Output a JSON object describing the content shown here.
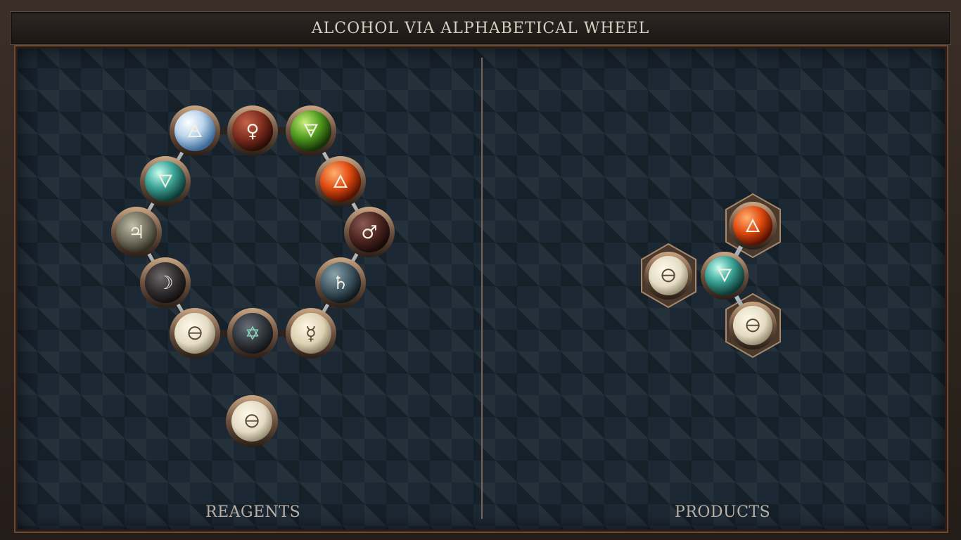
{
  "puzzle": {
    "title": "ALCOHOL VIA ALPHABETICAL WHEEL"
  },
  "panels": {
    "reagents_label": "REAGENTS",
    "products_label": "PRODUCTS"
  },
  "reagents": {
    "ring": [
      {
        "element": "air",
        "symbol": "🜁"
      },
      {
        "element": "copper",
        "symbol": "♀"
      },
      {
        "element": "earth",
        "symbol": "🜃"
      },
      {
        "element": "fire",
        "symbol": "🜂"
      },
      {
        "element": "iron",
        "symbol": "♂"
      },
      {
        "element": "lead",
        "symbol": "♄"
      },
      {
        "element": "quicksilver",
        "symbol": "☿"
      },
      {
        "element": "vitae",
        "symbol": "✡"
      },
      {
        "element": "salt",
        "symbol": "🜔"
      },
      {
        "element": "silver",
        "symbol": "☽"
      },
      {
        "element": "tin",
        "symbol": "♃"
      },
      {
        "element": "water",
        "symbol": "🜄"
      }
    ],
    "loose": [
      {
        "element": "salt",
        "symbol": "🜔"
      }
    ]
  },
  "products": {
    "molecule": [
      {
        "element": "fire",
        "symbol": "🜂"
      },
      {
        "element": "salt",
        "symbol": "🜔"
      },
      {
        "element": "water",
        "symbol": "🜄"
      },
      {
        "element": "salt",
        "symbol": "🜔"
      }
    ]
  },
  "colors": {
    "air": "#cfe6f7",
    "copper": "#7a2a1c",
    "earth": "#4f9a1e",
    "fire": "#e04a10",
    "iron": "#5a2a25",
    "lead": "#3e5560",
    "quicksilver": "#e6dcc0",
    "vitae": "#3a3f45",
    "salt": "#e4dcc4",
    "silver": "#3a3738",
    "tin": "#6b6858",
    "water": "#3fa89a",
    "rim": "#a88868"
  }
}
